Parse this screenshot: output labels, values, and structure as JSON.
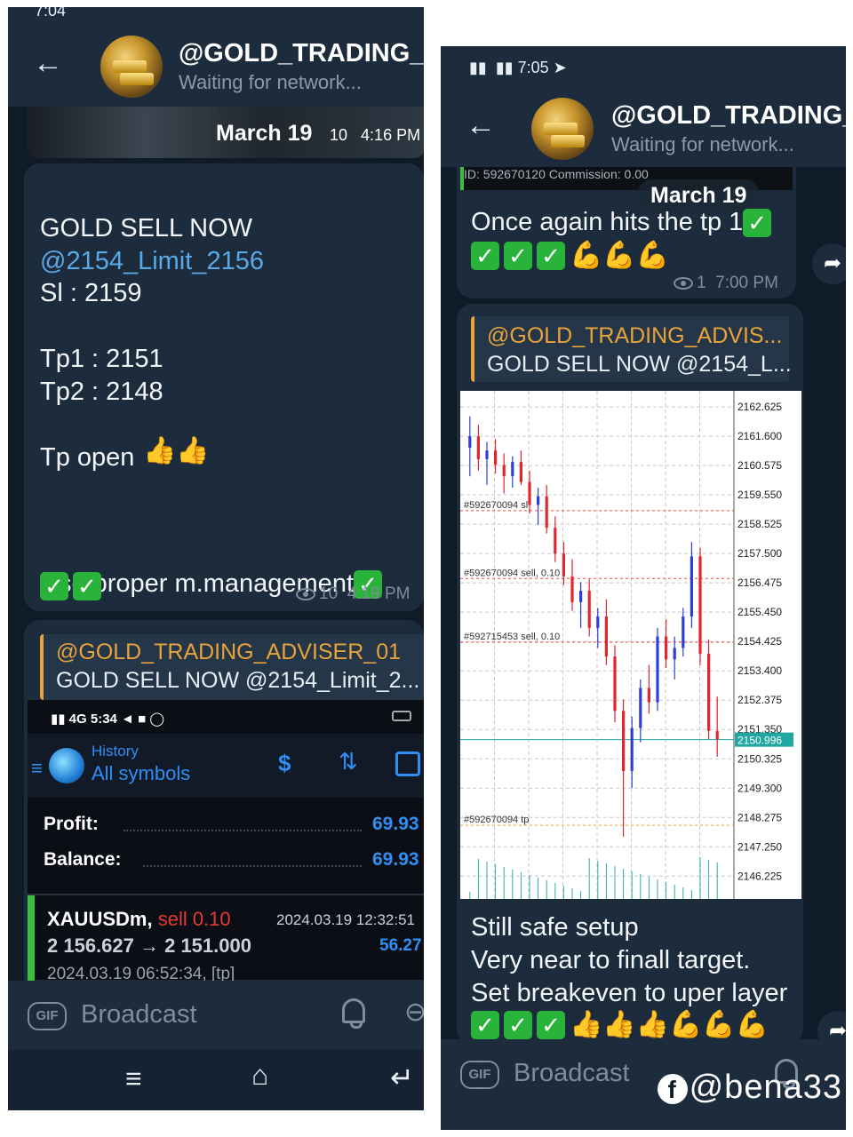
{
  "left": {
    "status_time": "7:04",
    "channel_title": "@GOLD_TRADING_AD",
    "channel_status": "Waiting for network...",
    "media_date": "March 19",
    "media_meta_views": "10",
    "media_meta_time": "4:16 PM",
    "message": {
      "line1": "GOLD SELL NOW ",
      "mention": "@2154_Limit_2156",
      "body": "Sl : 2159\n\nTp1 : 2151\nTp2 : 2148\n\nTp  open",
      "footer": "Use proper m.management",
      "views": "10",
      "time": "4:19 PM"
    },
    "reply": {
      "name": "@GOLD_TRADING_ADVISER_01",
      "text": "GOLD SELL NOW @2154_Limit_2..."
    },
    "mt": {
      "status_time": "5:34",
      "history_label": "History",
      "symbols_label": "All symbols",
      "profit_label": "Profit:",
      "profit_value": "69.93",
      "balance_label": "Balance:",
      "balance_value": "69.93",
      "deal_symbol": "XAUUSDm,",
      "deal_side": "sell 0.10",
      "deal_datetime": "2024.03.19 12:32:51",
      "deal_prices": "2 156.627 → 2 151.000",
      "deal_profit": "56.27",
      "deal_open": "2024.03.19 06:52:34, [tp]"
    },
    "input_placeholder": "Broadcast",
    "gif_label": "GIF"
  },
  "right": {
    "status_time": "7:05",
    "channel_title": "@GOLD_TRADING_A",
    "channel_status": "Waiting for network...",
    "clipped_line": "ID:          592670120     Commission:        0.00",
    "date_chip": "March 19",
    "message1": {
      "text": "Once again hits the tp 1",
      "views": "1",
      "time": "7:00 PM"
    },
    "reply": {
      "name": "@GOLD_TRADING_ADVIS...",
      "text": "GOLD SELL NOW @2154_L..."
    },
    "message2": {
      "line1": "Still safe setup",
      "line2": "Very near to finall target.",
      "line3": "Set breakeven to uper layer"
    },
    "input_placeholder": "Broadcast",
    "gif_label": "GIF"
  },
  "watermark": "@bena33",
  "chart_data": {
    "type": "candlestick",
    "y_ticks": [
      2162.625,
      2161.6,
      2160.575,
      2159.55,
      2158.525,
      2157.5,
      2156.475,
      2155.45,
      2154.425,
      2153.4,
      2152.375,
      2151.35,
      2150.325,
      2149.3,
      2148.275,
      2147.25,
      2146.225
    ],
    "y_tick_labels": [
      "2162.625",
      "2161.600",
      "2160.575",
      "2159.550",
      "2158.525",
      "2157.500",
      "2156.475",
      "2155.450",
      "2154.425",
      "2153.400",
      "2152.375",
      "2151.350",
      "2150.325",
      "2149.300",
      "2148.275",
      "2147.250",
      "2146.225"
    ],
    "ylim": [
      2145.8,
      2163.0
    ],
    "current_price": 2150.996,
    "current_price_label": "2150.996",
    "level_lines": [
      {
        "label": "#592670094 sl",
        "value": 2159.0,
        "color": "#e0513f"
      },
      {
        "label": "#592670094 sell, 0.10",
        "value": 2156.627,
        "color": "#e0513f"
      },
      {
        "label": "#592715453 sell, 0.10",
        "value": 2154.4,
        "color": "#e0513f"
      },
      {
        "label": "#592670094 tp",
        "value": 2148.0,
        "color": "#e8a33b"
      }
    ],
    "candles_ohlc": [
      [
        2161.2,
        2162.3,
        2160.2,
        2161.6
      ],
      [
        2161.6,
        2162.0,
        2160.4,
        2160.8
      ],
      [
        2160.8,
        2161.4,
        2159.9,
        2161.1
      ],
      [
        2161.1,
        2161.5,
        2160.3,
        2160.6
      ],
      [
        2160.6,
        2161.0,
        2159.6,
        2160.2
      ],
      [
        2160.2,
        2160.9,
        2159.8,
        2160.7
      ],
      [
        2160.7,
        2161.1,
        2159.9,
        2160.0
      ],
      [
        2160.0,
        2160.4,
        2158.9,
        2159.2
      ],
      [
        2159.2,
        2159.8,
        2158.5,
        2159.5
      ],
      [
        2159.5,
        2159.9,
        2158.2,
        2158.4
      ],
      [
        2158.4,
        2158.8,
        2157.2,
        2157.5
      ],
      [
        2157.5,
        2157.9,
        2156.4,
        2156.7
      ],
      [
        2156.7,
        2157.3,
        2155.5,
        2155.8
      ],
      [
        2155.8,
        2156.5,
        2154.9,
        2156.2
      ],
      [
        2156.2,
        2156.6,
        2154.6,
        2154.9
      ],
      [
        2154.9,
        2155.6,
        2154.2,
        2155.3
      ],
      [
        2155.3,
        2155.9,
        2153.6,
        2153.9
      ],
      [
        2153.9,
        2154.3,
        2151.6,
        2152.0
      ],
      [
        2152.0,
        2152.4,
        2147.6,
        2149.9
      ],
      [
        2149.9,
        2151.8,
        2149.3,
        2151.4
      ],
      [
        2151.4,
        2153.1,
        2150.9,
        2152.8
      ],
      [
        2152.8,
        2153.6,
        2151.9,
        2152.3
      ],
      [
        2152.3,
        2154.9,
        2152.0,
        2154.6
      ],
      [
        2154.6,
        2155.2,
        2153.5,
        2153.8
      ],
      [
        2153.8,
        2154.6,
        2153.1,
        2154.2
      ],
      [
        2154.2,
        2155.6,
        2153.9,
        2155.3
      ],
      [
        2155.3,
        2157.9,
        2154.9,
        2157.4
      ],
      [
        2157.4,
        2157.7,
        2153.6,
        2154.0
      ],
      [
        2154.0,
        2154.5,
        2151.0,
        2151.3
      ],
      [
        2151.3,
        2152.5,
        2150.4,
        2151.0
      ]
    ]
  }
}
